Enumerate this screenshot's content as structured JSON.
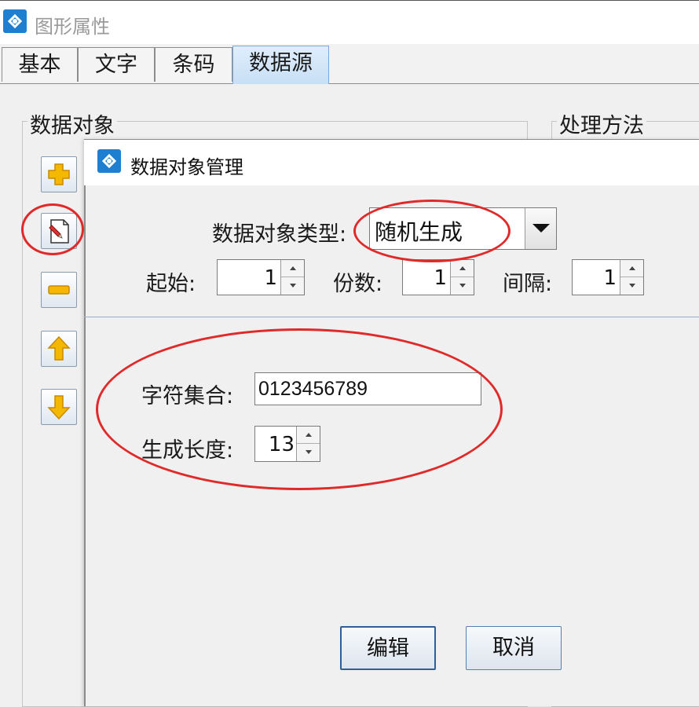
{
  "window": {
    "title": "图形属性",
    "app_icon": "app-logo-icon"
  },
  "tabs": [
    {
      "label": "基本",
      "active": false
    },
    {
      "label": "文字",
      "active": false
    },
    {
      "label": "条码",
      "active": false
    },
    {
      "label": "数据源",
      "active": true
    }
  ],
  "groups": {
    "data_object": "数据对象",
    "processing": "处理方法"
  },
  "side_buttons": [
    {
      "name": "add-icon"
    },
    {
      "name": "edit-icon"
    },
    {
      "name": "remove-icon"
    },
    {
      "name": "move-up-icon"
    },
    {
      "name": "move-down-icon"
    }
  ],
  "dialog": {
    "title": "数据对象管理",
    "type_label": "数据对象类型:",
    "type_value": "随机生成",
    "start_label": "起始:",
    "start_value": "1",
    "copies_label": "份数:",
    "copies_value": "1",
    "interval_label": "间隔:",
    "interval_value": "1",
    "charset_label": "字符集合:",
    "charset_value": "0123456789",
    "length_label": "生成长度:",
    "length_value": "13",
    "edit_button": "编辑",
    "cancel_button": "取消"
  },
  "colors": {
    "annotation": "#e02a2a",
    "active_tab": "#c8dff5",
    "icon_blue": "#1e7fd0"
  }
}
